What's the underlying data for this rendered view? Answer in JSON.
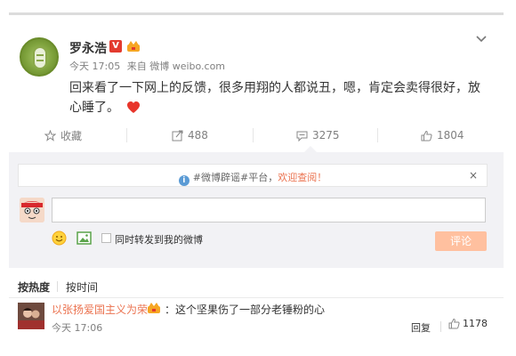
{
  "post": {
    "author": "罗永浩",
    "verified_badge": "V",
    "meta_time": "今天 17:05",
    "meta_source": "来自 微博 weibo.com",
    "text": "回来看了一下网上的反馈，很多用翔的人都说丑，嗯，肯定会卖得很好，放心睡了。",
    "avatar_icon": "green-mascot-avatar",
    "accent_color": "#eb7350"
  },
  "actions": {
    "favorite_label": "收藏",
    "repost_count": "488",
    "comment_count": "3275",
    "like_count": "1804"
  },
  "notice": {
    "hashtag": "#微博辟谣#平台，",
    "link_text": "欢迎查阅！",
    "close": "×"
  },
  "composer": {
    "input_value": "",
    "forward_label": "同时转发到我的微博",
    "submit_label": "评论",
    "submit_color": "#ffc09f"
  },
  "sort": {
    "hot": "按热度",
    "time": "按时间"
  },
  "comments": [
    {
      "user": "以张扬爱国主义为荣",
      "text": "：这个坚果伤了一部分老锤粉的心",
      "time": "今天 17:06",
      "reply_label": "回复",
      "likes": "1178"
    }
  ]
}
